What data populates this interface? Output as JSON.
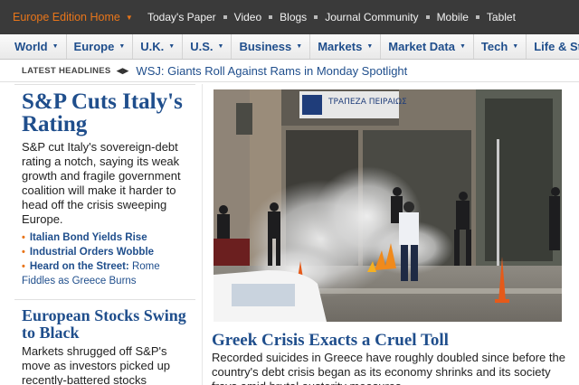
{
  "topbar": {
    "edition": "Europe Edition Home",
    "links": [
      "Today's Paper",
      "Video",
      "Blogs",
      "Journal Community",
      "Mobile",
      "Tablet"
    ]
  },
  "nav": {
    "items": [
      "World",
      "Europe",
      "U.K.",
      "U.S.",
      "Business",
      "Markets",
      "Market Data",
      "Tech",
      "Life & Style"
    ]
  },
  "latest": {
    "label": "LATEST HEADLINES",
    "headline": "WSJ: Giants Roll Against Rams in Monday Spotlight"
  },
  "lead": {
    "title": "S&P Cuts Italy's Rating",
    "body": "S&P cut Italy's sovereign-debt rating a notch, saying its weak growth and fragile government coalition will make it harder to head off the crisis sweeping Europe.",
    "related": [
      {
        "bold": "Italian Bond Yields Rise",
        "rest": ""
      },
      {
        "bold": "Industrial Orders Wobble",
        "rest": ""
      },
      {
        "bold": "Heard on the Street:",
        "rest": "Rome Fiddles as Greece Burns"
      }
    ]
  },
  "second": {
    "title": "European Stocks Swing to Black",
    "body": "Markets shrugged off S&P's move as investors picked up recently-battered stocks"
  },
  "photo": {
    "sign_text": "ΤΡΑΠΕΖΑ ΠΕΙΡΑΙΩΣ"
  },
  "main": {
    "title": "Greek Crisis Exacts a Cruel Toll",
    "body": "Recorded suicides in Greece have roughly doubled since before the country's debt crisis began as its economy shrinks and its society frays amid brutal austerity measures."
  },
  "colors": {
    "brand_blue": "#1f4e8c",
    "accent_orange": "#e8751a",
    "topbar_bg": "#3a3a3a"
  }
}
